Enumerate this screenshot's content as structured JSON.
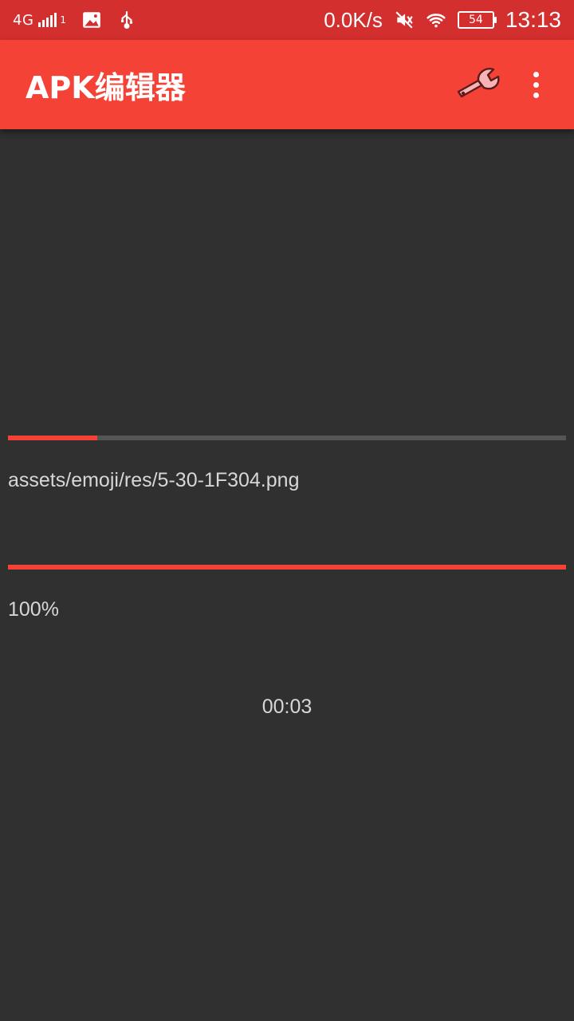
{
  "status_bar": {
    "network": "4G",
    "sim_slot": "1",
    "speed": "0.0K/s",
    "battery": "54",
    "time": "13:13",
    "icons": [
      "signal-icon",
      "image-icon",
      "usb-icon",
      "mute-icon",
      "wifi-icon",
      "battery-icon"
    ]
  },
  "app_bar": {
    "title": "APK编辑器",
    "actions": [
      "wrench-icon",
      "more-vert-icon"
    ]
  },
  "progress": {
    "task_progress": 0.16,
    "overall_progress": 1.0,
    "current_file": "assets/emoji/res/5-30-1F304.png",
    "percent_label": "100%",
    "elapsed": "00:03"
  },
  "colors": {
    "status_bar": "#d32f2f",
    "app_bar": "#f44336",
    "background": "#303030",
    "accent": "#f44336",
    "text": "#d7d7d7",
    "track": "#555555"
  }
}
